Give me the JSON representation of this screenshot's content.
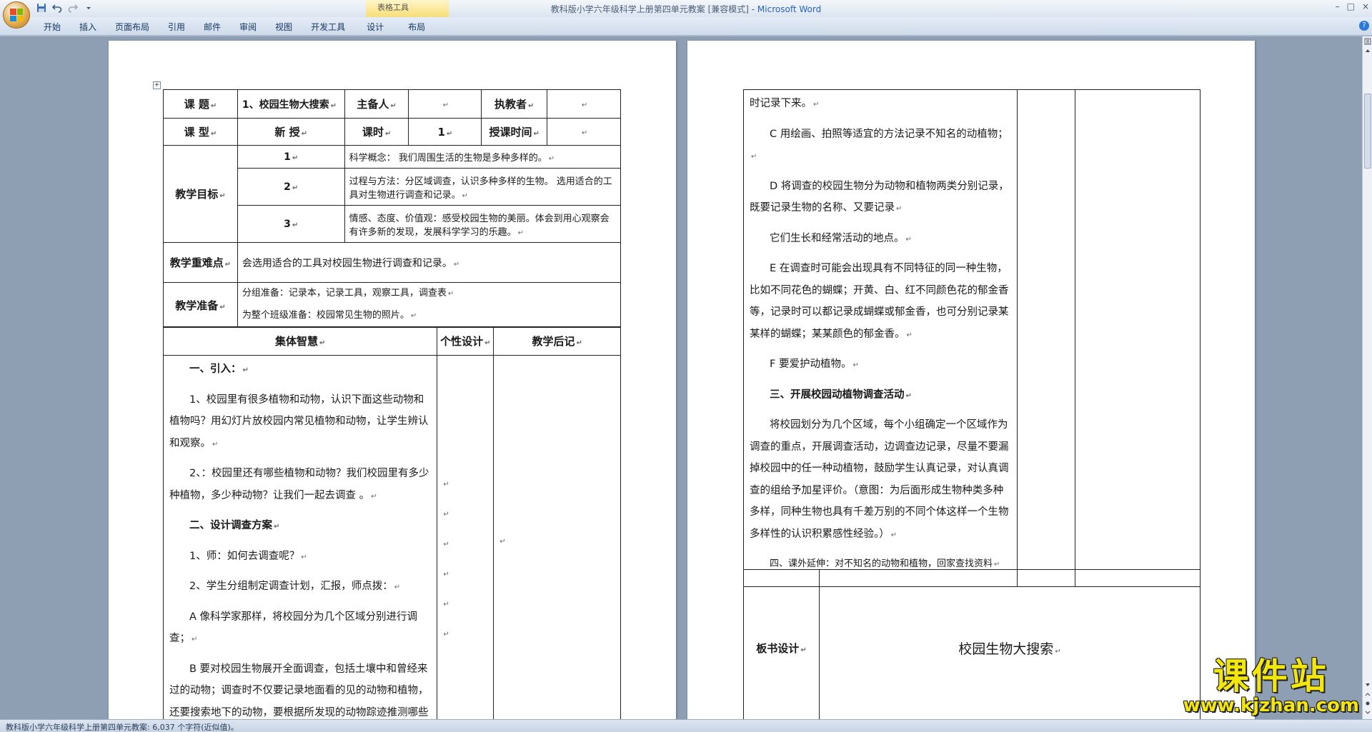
{
  "window": {
    "title": "教科版小学六年级科学上册第四单元教案 [兼容模式] - ",
    "app_name": "Microsoft Word",
    "context_tab_group": "表格工具",
    "controls": [
      "–",
      "□",
      "×"
    ]
  },
  "ribbon": {
    "tabs": [
      "开始",
      "插入",
      "页面布局",
      "引用",
      "邮件",
      "审阅",
      "视图",
      "开发工具"
    ],
    "context_tabs": [
      "设计",
      "布局"
    ],
    "help": "?"
  },
  "qat": {
    "save_icon": "save-icon",
    "undo_icon": "undo-icon",
    "redo_icon": "redo-icon",
    "customize_icon": "dropdown-icon"
  },
  "lesson": {
    "topic_label": "课 题",
    "topic": "1、校园生物大搜索",
    "preparer_label": "主备人",
    "preparer": "",
    "teacher_label": "执教者",
    "teacher": "",
    "type_label": "课 型",
    "type": "新 授",
    "hours_label": "课时",
    "hours": "1",
    "time_label": "授课时间",
    "time": "",
    "goals_label": "教学目标",
    "goals": [
      {
        "num": "1",
        "text": "科学概念： 我们周围生活的生物是多种多样的。"
      },
      {
        "num": "2",
        "text": "过程与方法：分区域调查，认识多种多样的生物。 选用适合的工具对生物进行调查和记录。"
      },
      {
        "num": "3",
        "text": "情感、态度、价值观：感受校园生物的美丽。体会到用心观察会有许多新的发现，发展科学学习的乐趣。"
      }
    ],
    "keypoint_label": "教学重难点",
    "keypoint": "会选用适合的工具对校园生物进行调查和记录。",
    "prep_label": "教学准备",
    "prep_group": "分组准备：记录本，记录工具，观察工具，调查表",
    "prep_class": "为整个班级准备：校园常见生物的照片。"
  },
  "columns": {
    "collective": "集体智慧",
    "personal": "个性设计",
    "notes": "教学后记"
  },
  "body_left": [
    {
      "text": "一、引入：",
      "bold": true
    },
    {
      "text": "1、校园里有很多植物和动物，认识下面这些动物和植物吗？用幻灯片放校园内常见植物和动物，让学生辨认和观察。",
      "bold": false
    },
    {
      "text": "2、：校园里还有哪些植物和动物？我们校园里有多少种植物，多少种动物？让我们一起去调查 。",
      "bold": false
    },
    {
      "text": "二、设计调查方案",
      "bold": true
    },
    {
      "text": "1、师：如何去调查呢？",
      "bold": false
    },
    {
      "text": "2、学生分组制定调查计划，汇报，师点拨：",
      "bold": false
    },
    {
      "text": "A 像科学家那样，将校园分为几个区域分别进行调查；",
      "bold": false
    },
    {
      "text": "B 要对校园生物展开全面调查，包括土壤中和曾经来过的动物；调查时不仅要记录地面看的见的动物和植物，还要搜索地下的动物，要根据所发现的动物踪迹推测哪些动物也在这里生活过。将这些发现都及",
      "bold": false
    }
  ],
  "body_right": [
    {
      "text": "时记录下来。",
      "bold": false,
      "indent": false
    },
    {
      "text": "C 用绘画、拍照等适宜的方法记录不知名的动植物；",
      "bold": false,
      "indent": true
    },
    {
      "text": "D 将调查的校园生物分为动物和植物两类分别记录，既要记录生物的名称、又要记录",
      "bold": false,
      "indent": true
    },
    {
      "text": "它们生长和经常活动的地点。",
      "bold": false,
      "indent": true
    },
    {
      "text": "E 在调查时可能会出现具有不同特征的同一种生物，比如不同花色的蝴蝶；开黄、白、红不同颜色花的郁金香等，记录时可以都记录成蝴蝶或郁金香，也可分别记录某某样的蝴蝶；某某颜色的郁金香。",
      "bold": false,
      "indent": true
    },
    {
      "text": "F 要爱护动植物。",
      "bold": false,
      "indent": true
    },
    {
      "text": "三、开展校园动植物调查活动",
      "bold": true,
      "indent": true
    },
    {
      "text": "将校园划分为几个区域，每个小组确定一个区域作为调查的重点，开展调查活动，边调查边记录，尽量不要漏掉校园中的任一种动植物，鼓励学生认真记录，对认真调查的组给予加星评价。（意图：为后面形成生物种类多种多样，同种生物也具有千差万别的不同个体这样一个生物多样性的认识积累感性经验。）",
      "bold": false,
      "indent": true
    },
    {
      "text": "四、课外延伸：对不知名的动物和植物，回家查找资料",
      "bold": false,
      "indent": true,
      "small": true
    }
  ],
  "board": {
    "label": "板书设计",
    "title": "校园生物大搜索"
  },
  "statusbar": {
    "text": "教科版小学六年级科学上册第四单元教案: 6,037 个字符(近似值)。"
  },
  "watermark": {
    "big": "课件站",
    "small": "www.kjzhan.com"
  },
  "marks": {
    "para": "↵"
  }
}
